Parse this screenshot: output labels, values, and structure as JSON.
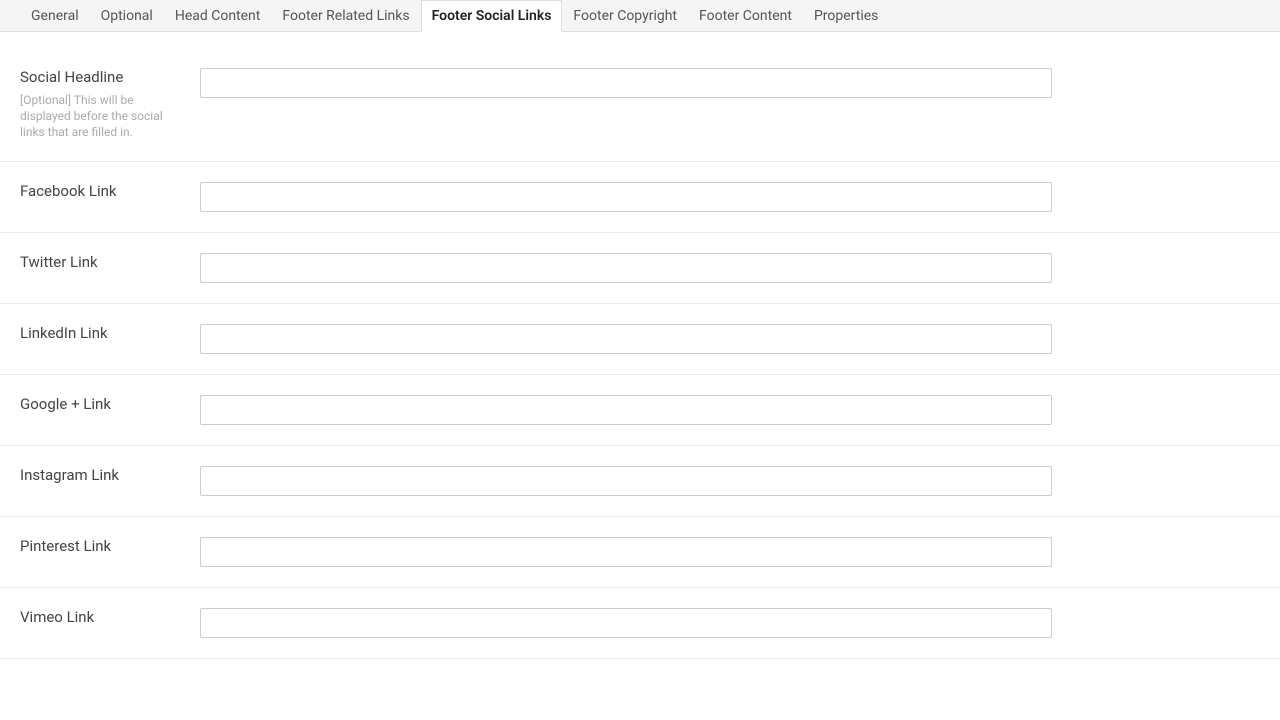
{
  "tabs": [
    {
      "label": "General",
      "active": false
    },
    {
      "label": "Optional",
      "active": false
    },
    {
      "label": "Head Content",
      "active": false
    },
    {
      "label": "Footer Related Links",
      "active": false
    },
    {
      "label": "Footer Social Links",
      "active": true
    },
    {
      "label": "Footer Copyright",
      "active": false
    },
    {
      "label": "Footer Content",
      "active": false
    },
    {
      "label": "Properties",
      "active": false
    }
  ],
  "fields": {
    "social_headline": {
      "label": "Social Headline",
      "help": "[Optional] This will be displayed before the social links that are filled in.",
      "value": ""
    },
    "facebook": {
      "label": "Facebook Link",
      "value": ""
    },
    "twitter": {
      "label": "Twitter Link",
      "value": ""
    },
    "linkedin": {
      "label": "LinkedIn Link",
      "value": ""
    },
    "googleplus": {
      "label": "Google + Link",
      "value": ""
    },
    "instagram": {
      "label": "Instagram Link",
      "value": ""
    },
    "pinterest": {
      "label": "Pinterest Link",
      "value": ""
    },
    "vimeo": {
      "label": "Vimeo Link",
      "value": ""
    }
  }
}
